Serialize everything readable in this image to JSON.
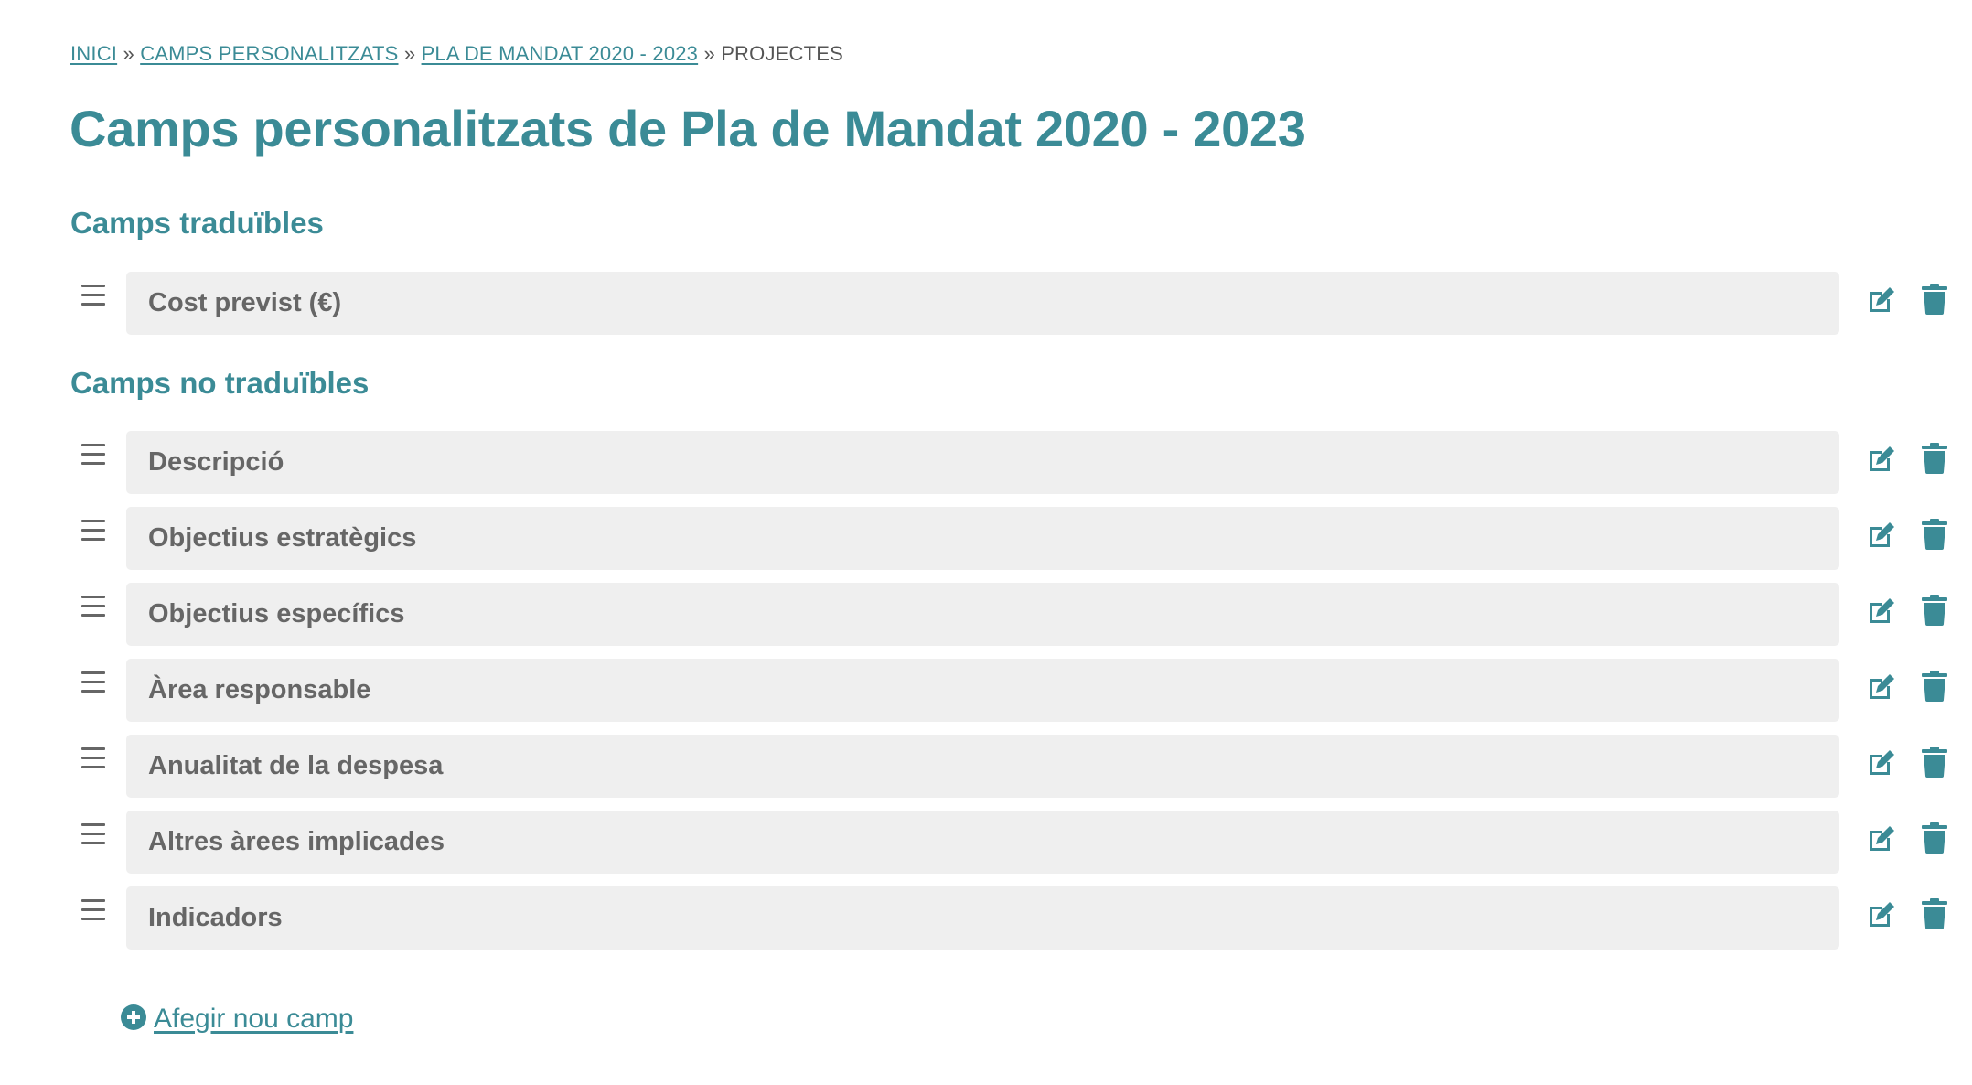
{
  "breadcrumb": {
    "home": "INICI",
    "custom_fields": "CAMPS PERSONALITZATS",
    "plan": "PLA DE MANDAT 2020 - 2023",
    "current": "PROJECTES",
    "separator": "»"
  },
  "page_title": "Camps personalitzats de Pla de Mandat 2020 - 2023",
  "translatable": {
    "title": "Camps traduïbles",
    "fields": [
      "Cost previst (€)"
    ]
  },
  "non_translatable": {
    "title": "Camps no traduïbles",
    "fields": [
      "Descripció",
      "Objectius estratègics",
      "Objectius específics",
      "Àrea responsable",
      "Anualitat de la despesa",
      "Altres àrees implicades",
      "Indicadors"
    ]
  },
  "add_field_label": "Afegir nou camp",
  "icons": {
    "drag": "drag-handle-icon",
    "edit": "edit-icon",
    "delete": "trash-icon",
    "add": "plus-circle-icon"
  },
  "colors": {
    "accent": "#3b8b96",
    "field_bg": "#efefef",
    "field_text": "#666666",
    "muted_text": "#555555"
  }
}
